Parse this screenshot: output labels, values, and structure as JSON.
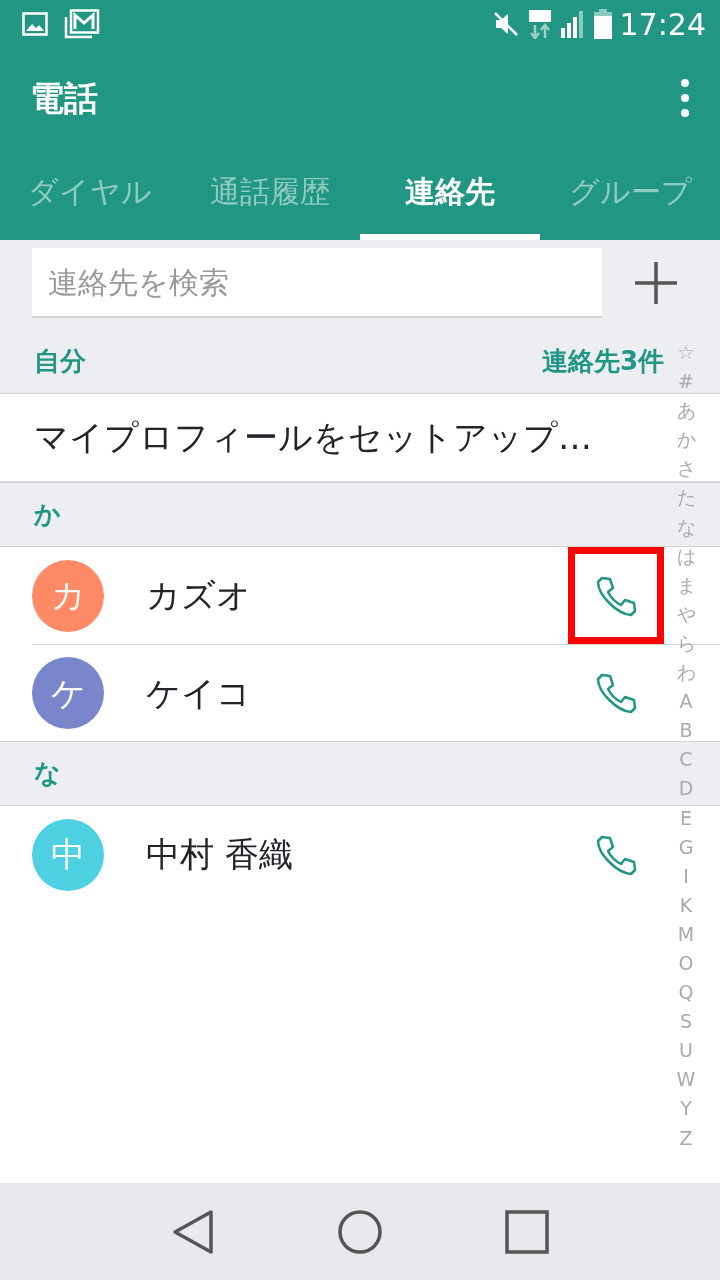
{
  "status_bar": {
    "time": "17:24"
  },
  "app_bar": {
    "title": "電話"
  },
  "tabs": [
    {
      "label": "ダイヤル",
      "selected": false
    },
    {
      "label": "通話履歴",
      "selected": false
    },
    {
      "label": "連絡先",
      "selected": true
    },
    {
      "label": "グループ",
      "selected": false
    }
  ],
  "search": {
    "placeholder": "連絡先を検索"
  },
  "sections": [
    {
      "header": "自分",
      "count": "連絡先3件",
      "items": [
        {
          "kind": "profile",
          "label": "マイプロフィールをセットアップ…"
        }
      ]
    },
    {
      "header": "か",
      "items": [
        {
          "kind": "contact",
          "initial": "カ",
          "name": "カズオ",
          "color": "#ff8a65",
          "highlighted": true
        },
        {
          "kind": "contact",
          "initial": "ケ",
          "name": "ケイコ",
          "color": "#7986cb",
          "highlighted": false
        }
      ]
    },
    {
      "header": "な",
      "items": [
        {
          "kind": "contact",
          "initial": "中",
          "name": "中村 香織",
          "color": "#4dd0e1",
          "highlighted": false
        }
      ]
    }
  ],
  "index": [
    "☆",
    "#",
    "あ",
    "か",
    "さ",
    "た",
    "な",
    "は",
    "ま",
    "や",
    "ら",
    "わ",
    "A",
    "B",
    "C",
    "D",
    "E",
    "G",
    "I",
    "K",
    "M",
    "O",
    "Q",
    "S",
    "U",
    "W",
    "Y",
    "Z"
  ]
}
